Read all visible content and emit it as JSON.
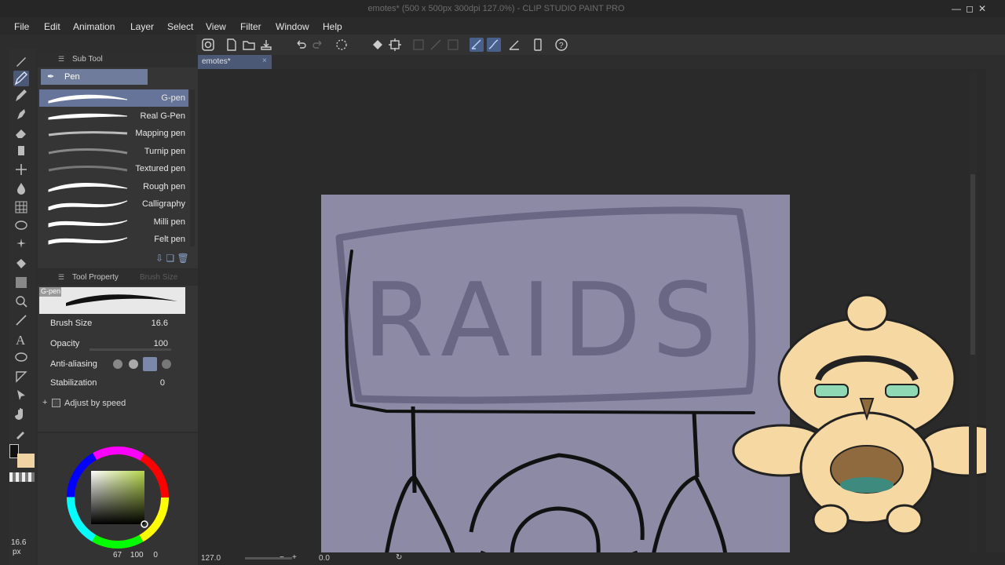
{
  "window": {
    "title": "emotes* (500 x 500px 300dpi 127.0%) - CLIP STUDIO PAINT PRO",
    "controls": [
      "minimize",
      "maximize",
      "close"
    ]
  },
  "menu": [
    "File",
    "Edit",
    "Animation",
    "Layer",
    "Select",
    "View",
    "Filter",
    "Window",
    "Help"
  ],
  "subtool_panel": {
    "header": "Sub Tool",
    "group_tab": "Pen",
    "brushes": [
      {
        "name": "G-pen",
        "selected": true
      },
      {
        "name": "Real G-Pen",
        "selected": false
      },
      {
        "name": "Mapping pen",
        "selected": false
      },
      {
        "name": "Turnip pen",
        "selected": false
      },
      {
        "name": "Textured pen",
        "selected": false
      },
      {
        "name": "Rough pen",
        "selected": false
      },
      {
        "name": "Calligraphy",
        "selected": false
      },
      {
        "name": "Milli pen",
        "selected": false
      },
      {
        "name": "Felt pen",
        "selected": false
      }
    ]
  },
  "tool_property": {
    "header": "Tool Property",
    "header2": "Brush Size",
    "preset_name": "G-pen",
    "brush_size_label": "Brush Size",
    "brush_size_value": "16.6",
    "opacity_label": "Opacity",
    "opacity_value": "100",
    "antialias_label": "Anti-aliasing",
    "stabilization_label": "Stabilization",
    "stabilization_value": "0",
    "adjust_label": "Adjust by speed"
  },
  "color_panel": {
    "left_size_value": "16.6",
    "left_size_unit": "px",
    "hsv_h": "67",
    "hsv_s": "100",
    "hsv_v": "0",
    "wheel_color": "#b5d64a"
  },
  "canvas": {
    "tab_label": "emotes*",
    "sketch_text": "RAIDS",
    "paper_color": "#8c8aa4"
  },
  "status": {
    "zoom": "127.0",
    "rotation": "0.0"
  },
  "colors": {
    "accent": "#67749a",
    "panel": "#353535",
    "background": "#2a2a2a",
    "mascot_body": "#f6d9a2",
    "mascot_glasses": "#8fd9b4"
  }
}
